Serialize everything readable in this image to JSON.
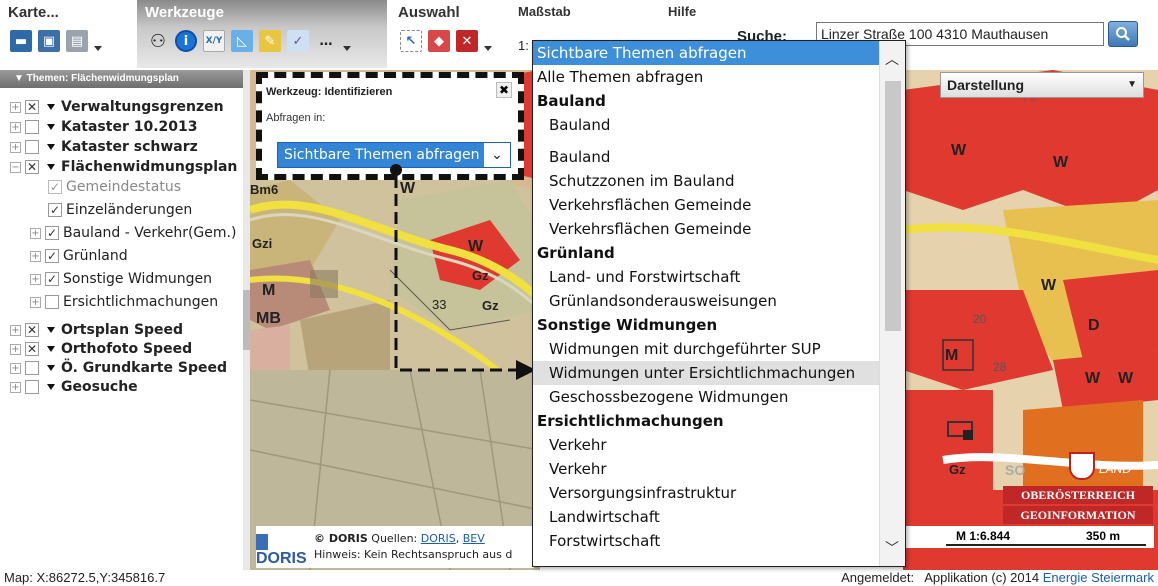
{
  "toolbar": {
    "karte": "Karte...",
    "werkzeuge": "Werkzeuge",
    "auswahl": "Auswahl",
    "massstab": "Maßstab",
    "massstab_value": "1:",
    "hilfe": "Hilfe",
    "search_label": "Suche:",
    "search_value": "Linzer Straße 100 4310 Mauthausen"
  },
  "layers": {
    "header": "▼ Themen: Flächenwidmungsplan",
    "items": [
      {
        "label": "Verwaltungsgrenzen"
      },
      {
        "label": "Kataster 10.2013"
      },
      {
        "label": "Kataster schwarz"
      },
      {
        "label": "Flächenwidmungsplan"
      },
      {
        "label": "Gemeindestatus"
      },
      {
        "label": "Einzeländerungen"
      },
      {
        "label": "Bauland - Verkehr(Gem.)"
      },
      {
        "label": "Grünland"
      },
      {
        "label": "Sonstige Widmungen"
      },
      {
        "label": "Ersichtlichmachungen"
      },
      {
        "label": "Ortsplan Speed"
      },
      {
        "label": "Orthofoto Speed"
      },
      {
        "label": "Ö. Grundkarte Speed"
      },
      {
        "label": "Geosuche"
      }
    ]
  },
  "identify": {
    "title": "Werkzeug: Identifizieren",
    "close": "✖",
    "label": "Abfragen in:",
    "selected": "Sichtbare Themen abfragen"
  },
  "dropdown": {
    "items": [
      {
        "label": "Sichtbare Themen abfragen"
      },
      {
        "label": "Alle Themen abfragen"
      },
      {
        "label": "Bauland"
      },
      {
        "label": "Bauland"
      },
      {
        "label": "Bauland"
      },
      {
        "label": "Schutzzonen im Bauland"
      },
      {
        "label": "Verkehrsflächen Gemeinde"
      },
      {
        "label": "Verkehrsflächen Gemeinde"
      },
      {
        "label": "Grünland"
      },
      {
        "label": "Land- und Forstwirtschaft"
      },
      {
        "label": "Grünlandsonderausweisungen"
      },
      {
        "label": "Sonstige Widmungen"
      },
      {
        "label": "Widmungen mit durchgeführter SUP"
      },
      {
        "label": "Widmungen unter Ersichtlichmachungen"
      },
      {
        "label": "Geschossbezogene Widmungen"
      },
      {
        "label": "Ersichtlichmachungen"
      },
      {
        "label": "Verkehr"
      },
      {
        "label": "Verkehr"
      },
      {
        "label": "Versorgungsinfrastruktur"
      },
      {
        "label": "Landwirtschaft"
      },
      {
        "label": "Forstwirtschaft"
      }
    ]
  },
  "darstellung": "Darstellung",
  "map": {
    "scale": "M 1:6.844",
    "scalebar": "350 m",
    "credit_doris": "© DORIS",
    "credit_quellen": "Quellen:",
    "credit_link1": "DORIS",
    "credit_link2": "BEV",
    "credit_hinweis": "Hinweis: Kein Rechtsanspruch aus d",
    "logo_text_1": "OBERÖSTERREICH",
    "logo_text_2": "GEOINFORMATION",
    "logo_small": "LAND",
    "doris_logo": "DORIS",
    "labels": {
      "bm6": "Bm6",
      "gzi": "Gzi",
      "w1": "W",
      "w2": "W",
      "gz1": "Gz",
      "gz2": "Gz",
      "m": "M",
      "mb": "MB",
      "n33": "33",
      "w3": "W",
      "w4": "W",
      "w5": "W",
      "d": "D",
      "m2": "M",
      "w6": "W",
      "w7": "W",
      "gz3": "Gz",
      "so": "SO",
      "n28": "28",
      "n20": "20",
      "fz": "FZ"
    }
  },
  "status": {
    "coords": "Map: X:86272.5,Y:345816.7",
    "logged": "Angemeldet:",
    "app": "Applikation (c) 2014",
    "link": "Energie Steiermark"
  }
}
